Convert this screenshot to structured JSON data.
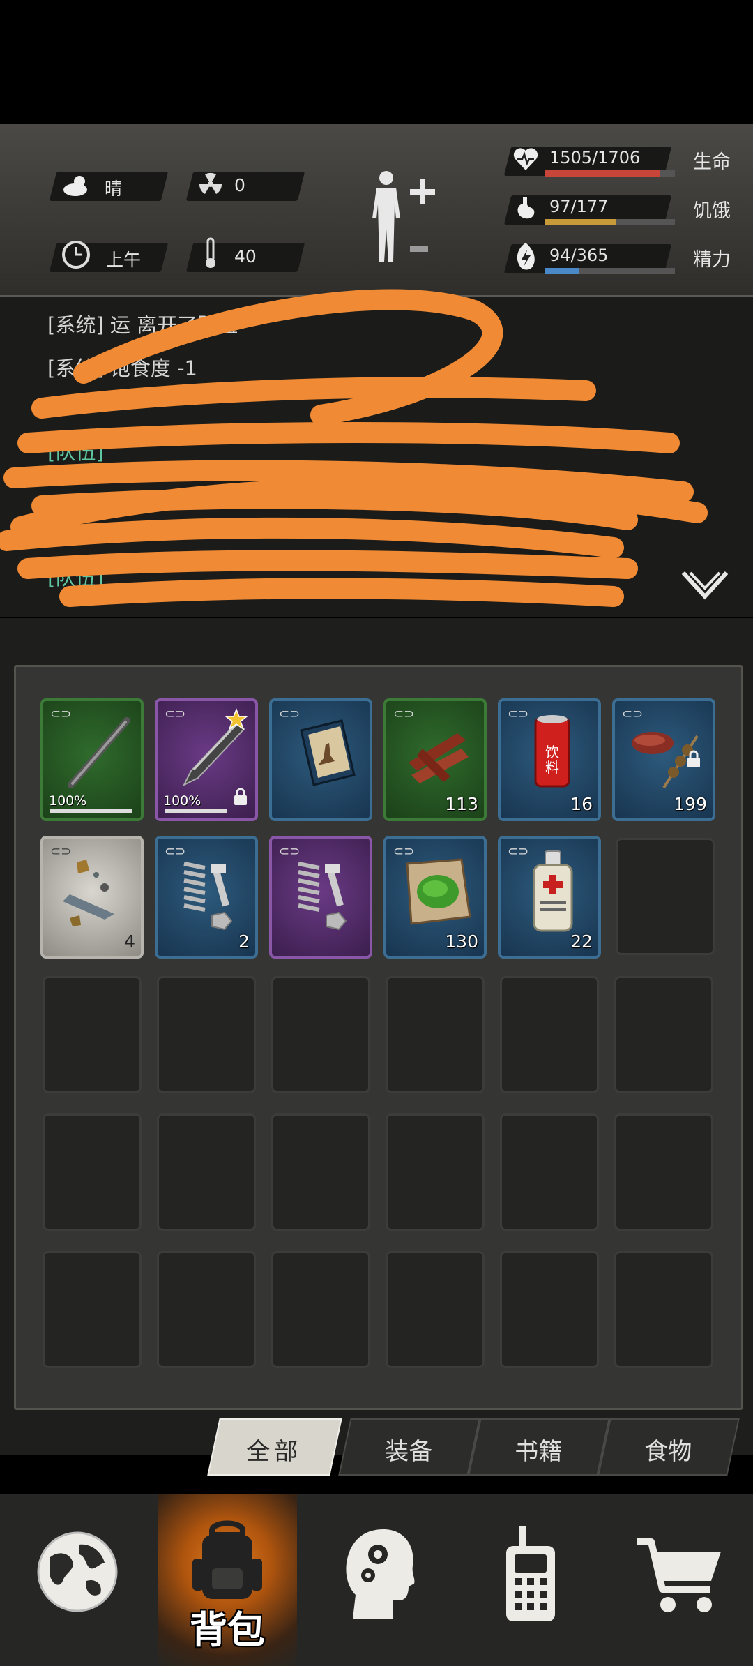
{
  "status": {
    "weather": "晴",
    "radiation": "0",
    "time_of_day": "上午",
    "temperature": "40",
    "health": {
      "text": "1505/1706",
      "label": "生命",
      "fraction": 0.882,
      "color": "#c8453a"
    },
    "hunger": {
      "text": "97/177",
      "label": "饥饿",
      "fraction": 0.548,
      "color": "#c99a3a"
    },
    "energy": {
      "text": "94/365",
      "label": "精力",
      "fraction": 0.258,
      "color": "#4a88c8"
    }
  },
  "log": {
    "lines": [
      {
        "text": "[系统] 运 离开了队伍",
        "color": "#d6d6d6"
      },
      {
        "text": "[系统] 饱食度 -1",
        "color": "#d6d6d6"
      },
      {
        "text": "[队伍]",
        "color": "#5fc7a0"
      },
      {
        "text": "[队伍]",
        "color": "#5fc7a0"
      }
    ],
    "collapse_icon": "chevron-down-icon"
  },
  "inventory": {
    "items": [
      {
        "name": "stick",
        "rarity": "green",
        "durability": "100%",
        "count": ""
      },
      {
        "name": "machete",
        "rarity": "purple",
        "durability": "100%",
        "count": "",
        "starred": true,
        "locked": true
      },
      {
        "name": "book",
        "rarity": "blue",
        "durability": "",
        "count": ""
      },
      {
        "name": "jerky",
        "rarity": "green",
        "durability": "",
        "count": "113"
      },
      {
        "name": "drink-can",
        "rarity": "blue",
        "durability": "",
        "count": "16",
        "can_label": "饮料"
      },
      {
        "name": "meat-skewer",
        "rarity": "blue",
        "durability": "",
        "count": "199",
        "locked": true
      },
      {
        "name": "scrap",
        "rarity": "white",
        "durability": "",
        "count": "4"
      },
      {
        "name": "spring-bolt",
        "rarity": "blue",
        "durability": "",
        "count": "2"
      },
      {
        "name": "spring-bolt",
        "rarity": "purple",
        "durability": "",
        "count": ""
      },
      {
        "name": "herb",
        "rarity": "blue",
        "durability": "",
        "count": "130"
      },
      {
        "name": "medicine-bottle",
        "rarity": "blue",
        "durability": "",
        "count": "22"
      }
    ]
  },
  "tabs": [
    {
      "label": "全部",
      "active": true
    },
    {
      "label": "装备",
      "active": false
    },
    {
      "label": "书籍",
      "active": false
    },
    {
      "label": "食物",
      "active": false
    }
  ],
  "nav": {
    "backpack_label": "背包",
    "items": [
      "globe-icon",
      "backpack-icon",
      "brain-head-icon",
      "walkie-talkie-icon",
      "cart-icon"
    ]
  }
}
